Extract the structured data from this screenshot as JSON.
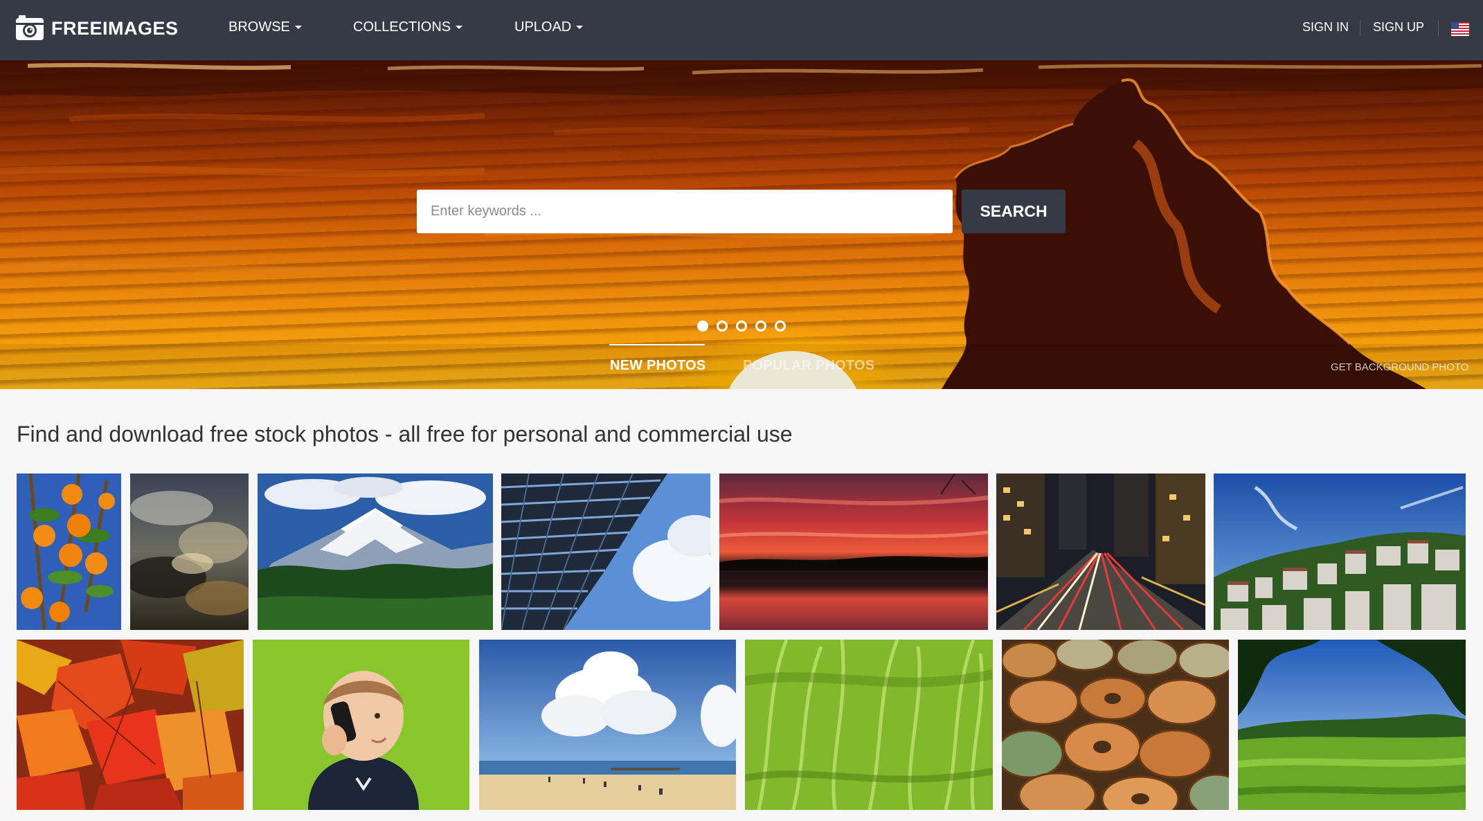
{
  "navbar": {
    "brand": "FREEIMAGES",
    "menu": [
      {
        "label": "BROWSE"
      },
      {
        "label": "COLLECTIONS"
      },
      {
        "label": "UPLOAD"
      }
    ],
    "sign_in": "SIGN IN",
    "sign_up": "SIGN UP",
    "language_flag": "us-flag-icon"
  },
  "hero": {
    "search_placeholder": "Enter keywords ...",
    "search_button": "SEARCH",
    "slide_count": 5,
    "active_slide": 1,
    "tabs": [
      "NEW PHOTOS",
      "POPULAR PHOTOS"
    ],
    "active_tab": "NEW PHOTOS",
    "get_background": "GET BACKGROUND PHOTO"
  },
  "main": {
    "headline": "Find and download free stock photos - all free for personal and commercial use",
    "photos_row1": [
      "oranges",
      "storm-clouds",
      "snowy-mountain",
      "skyscraper",
      "red-sunset-lake",
      "city-street-night",
      "hillside-town"
    ],
    "photos_row2": [
      "autumn-leaves",
      "child-phone",
      "beach-clouds",
      "green-grass",
      "coins",
      "green-field"
    ]
  },
  "colors": {
    "navbar_bg": "#353b45",
    "page_bg": "#f7f7f7",
    "text": "#333333"
  }
}
